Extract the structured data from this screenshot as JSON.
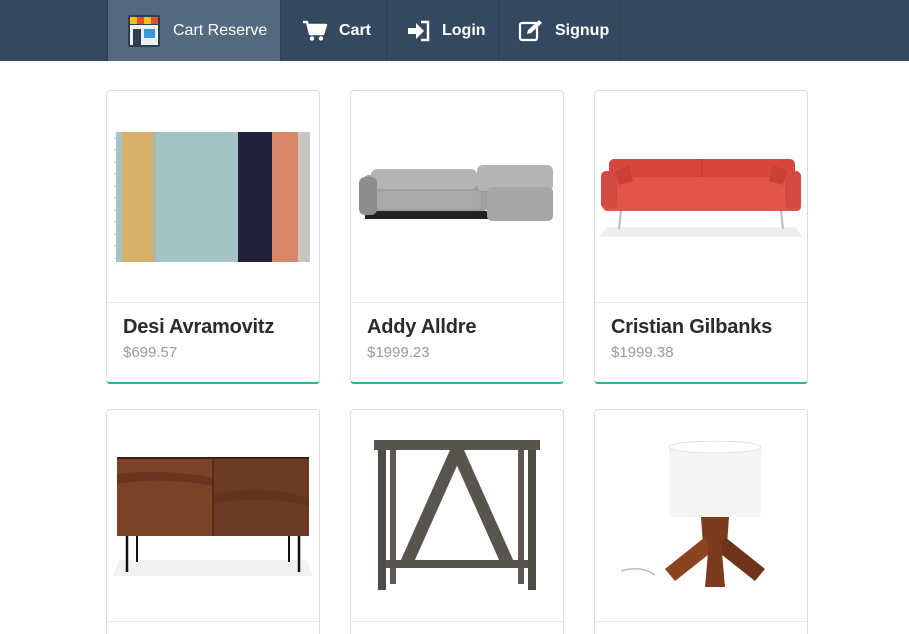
{
  "nav": {
    "brand": {
      "label": "Cart Reserve",
      "icon": "storefront-icon"
    },
    "items": [
      {
        "label": "Cart",
        "icon": "shopping-cart-icon"
      },
      {
        "label": "Login",
        "icon": "sign-in-icon"
      },
      {
        "label": "Signup",
        "icon": "edit-icon"
      }
    ]
  },
  "products": [
    {
      "name": "Desi Avramovitz",
      "price": "$699.57",
      "image": "striped-rug"
    },
    {
      "name": "Addy Alldre",
      "price": "$1999.23",
      "image": "grey-sectional-sofa"
    },
    {
      "name": "Cristian Gilbanks",
      "price": "$1999.38",
      "image": "red-sofa"
    },
    {
      "name": "",
      "price": "",
      "image": "walnut-credenza"
    },
    {
      "name": "",
      "price": "",
      "image": "metal-side-table"
    },
    {
      "name": "",
      "price": "",
      "image": "wood-table-lamp"
    }
  ],
  "colors": {
    "navbar": "#34495e",
    "brand_active": "#536a80",
    "accent": "#1abc9c"
  }
}
